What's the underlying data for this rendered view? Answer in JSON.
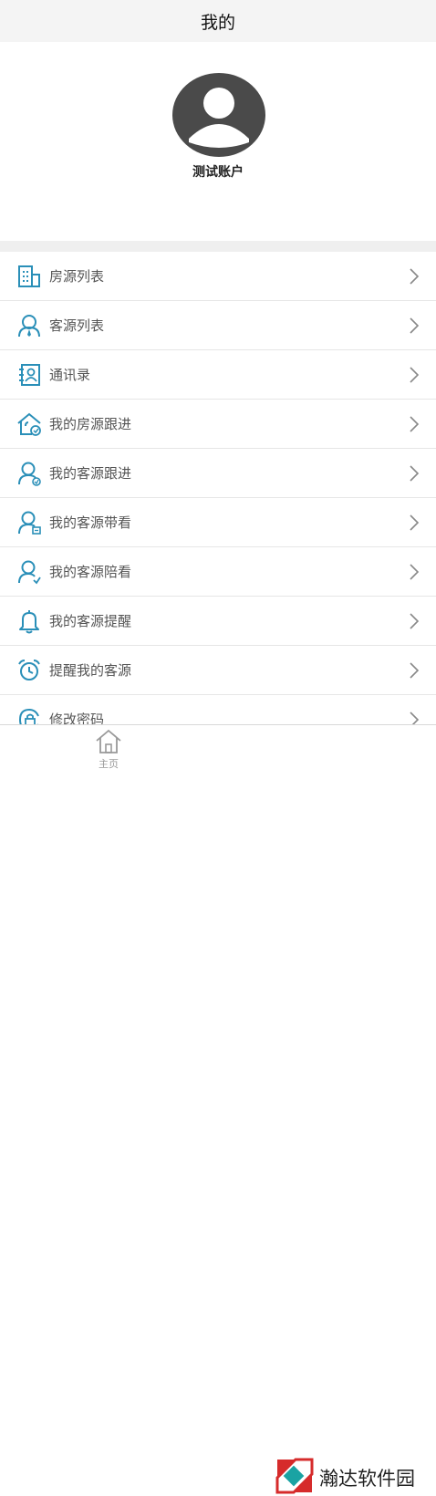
{
  "header": {
    "title": "我的"
  },
  "profile": {
    "account_name": "测试账户",
    "avatar_icon": "user-avatar-icon"
  },
  "menu": {
    "items": [
      {
        "label": "房源列表",
        "icon": "building-icon"
      },
      {
        "label": "客源列表",
        "icon": "customer-icon"
      },
      {
        "label": "通讯录",
        "icon": "contacts-icon"
      },
      {
        "label": "我的房源跟进",
        "icon": "house-follow-icon"
      },
      {
        "label": "我的客源跟进",
        "icon": "customer-follow-icon"
      },
      {
        "label": "我的客源带看",
        "icon": "customer-viewing-icon"
      },
      {
        "label": "我的客源陪看",
        "icon": "customer-accompany-icon"
      },
      {
        "label": "我的客源提醒",
        "icon": "bell-icon"
      },
      {
        "label": "提醒我的客源",
        "icon": "alarm-clock-icon"
      },
      {
        "label": "修改密码",
        "icon": "password-icon"
      }
    ]
  },
  "tabbar": {
    "home_label": "主页"
  },
  "watermark": {
    "text": "瀚达软件园"
  },
  "colors": {
    "accent": "#2a8fb8",
    "header_bg": "#f4f4f4",
    "divider": "#e6e6e6"
  }
}
